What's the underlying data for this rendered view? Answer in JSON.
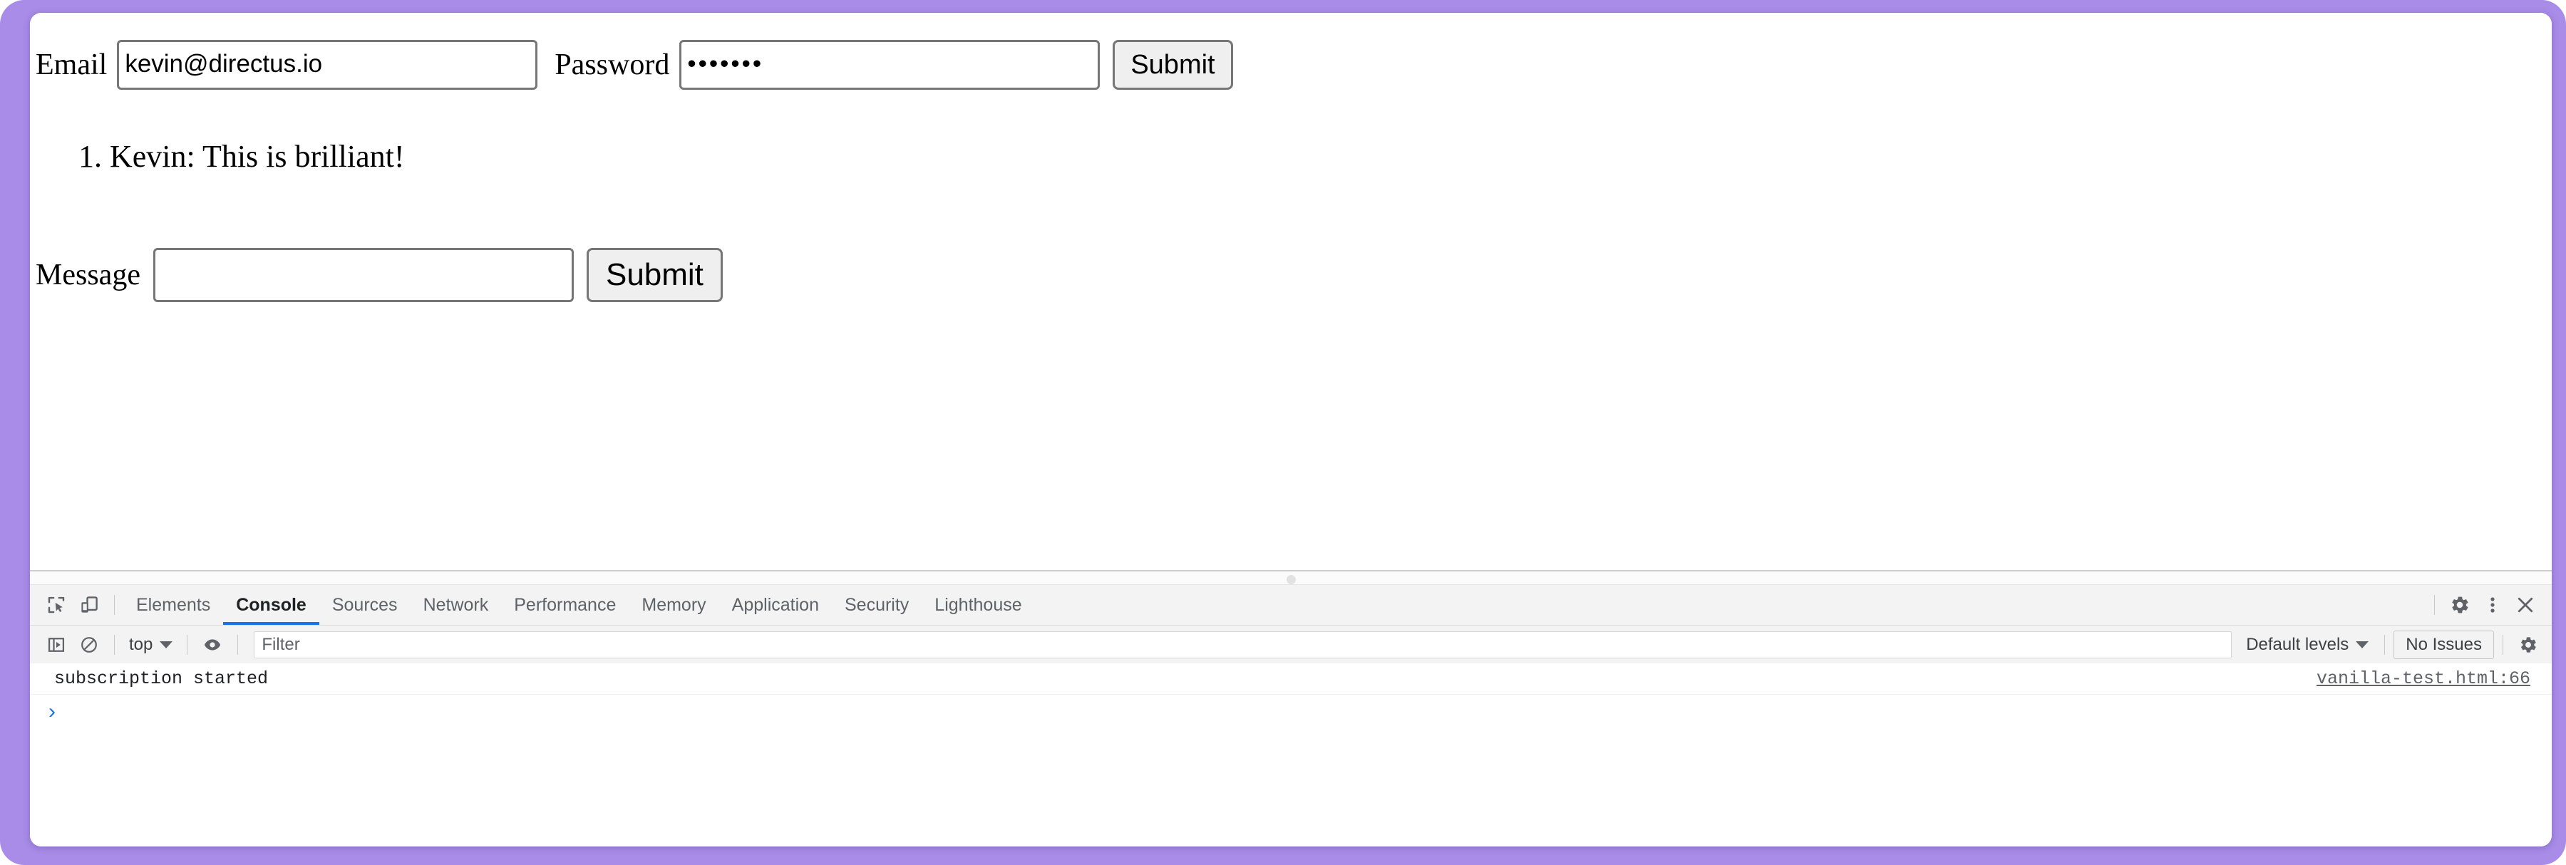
{
  "window": {
    "frame_color": "#a88ce8"
  },
  "page": {
    "login_form": {
      "email_label": "Email",
      "email_value": "kevin@directus.io",
      "email_placeholder": "",
      "password_label": "Password",
      "password_value": "•••••••",
      "password_placeholder": "",
      "submit_label": "Submit"
    },
    "messages": [
      "Kevin: This is brilliant!"
    ],
    "message_form": {
      "label": "Message",
      "value": "",
      "placeholder": "",
      "submit_label": "Submit"
    }
  },
  "devtools": {
    "left_icons": [
      {
        "name": "inspect-element-icon",
        "title": "Inspect element"
      },
      {
        "name": "device-toolbar-icon",
        "title": "Toggle device toolbar"
      }
    ],
    "tabs": [
      {
        "label": "Elements",
        "active": false
      },
      {
        "label": "Console",
        "active": true
      },
      {
        "label": "Sources",
        "active": false
      },
      {
        "label": "Network",
        "active": false
      },
      {
        "label": "Performance",
        "active": false
      },
      {
        "label": "Memory",
        "active": false
      },
      {
        "label": "Application",
        "active": false
      },
      {
        "label": "Security",
        "active": false
      },
      {
        "label": "Lighthouse",
        "active": false
      }
    ],
    "right_icons": [
      {
        "name": "settings-gear-icon",
        "title": "Settings"
      },
      {
        "name": "more-options-icon",
        "title": "Customize and control DevTools"
      },
      {
        "name": "close-icon",
        "title": "Close DevTools"
      }
    ],
    "console_toolbar": {
      "sidebar_toggle": "console-sidebar-icon",
      "clear_console": "clear-console-icon",
      "context": "top",
      "eye_icon": "live-expression-eye-icon",
      "filter_placeholder": "Filter",
      "filter_value": "",
      "levels": "Default levels",
      "issues": "No Issues",
      "settings_icon": "console-settings-gear-icon"
    },
    "console_log": [
      {
        "message": "subscription started",
        "source": "vanilla-test.html:66"
      }
    ],
    "prompt": {
      "chevron": "›",
      "value": "",
      "placeholder": ""
    },
    "accent_color": "#1a73e8"
  }
}
